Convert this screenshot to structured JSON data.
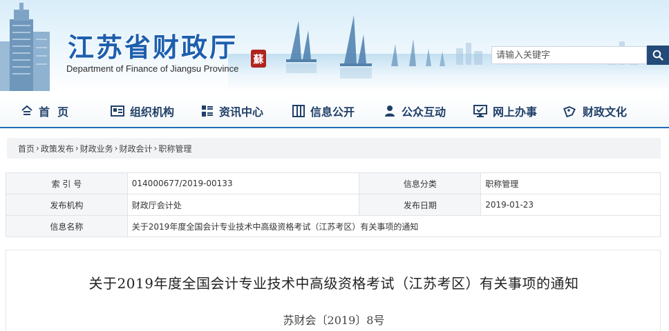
{
  "header": {
    "logo_title": "江苏省财政厅",
    "logo_subtitle": "Department of Finance of Jiangsu Province",
    "seal_char": "蘇",
    "search": {
      "placeholder": "请输入关键字",
      "icon": "search-icon"
    },
    "colors": {
      "title": "#1d5fae",
      "search_button": "#234a78",
      "seal": "#b0241e"
    }
  },
  "nav": {
    "items": [
      {
        "label": "首  页",
        "icon": "home-icon"
      },
      {
        "label": "组织机构",
        "icon": "org-card-icon"
      },
      {
        "label": "资讯中心",
        "icon": "news-icon"
      },
      {
        "label": "信息公开",
        "icon": "columns-icon"
      },
      {
        "label": "公众互动",
        "icon": "user-icon"
      },
      {
        "label": "网上办事",
        "icon": "monitor-check-icon"
      },
      {
        "label": "财政文化",
        "icon": "culture-icon"
      }
    ],
    "accent": "#1d6fb5"
  },
  "breadcrumb": {
    "items": [
      "首页",
      "政策发布",
      "财政业务",
      "财政会计",
      "职称管理"
    ],
    "separator": "›"
  },
  "info_table": {
    "rows": [
      [
        {
          "label": "索 引 号",
          "value": "014000677/2019-00133"
        },
        {
          "label": "信息分类",
          "value": "职称管理"
        }
      ],
      [
        {
          "label": "发布机构",
          "value": "财政厅会计处"
        },
        {
          "label": "发布日期",
          "value": "2019-01-23"
        }
      ],
      [
        {
          "label": "信息名称",
          "value": "关于2019年度全国会计专业技术中高级资格考试（江苏考区）有关事项的通知"
        }
      ]
    ]
  },
  "article": {
    "title": "关于2019年度全国会计专业技术中高级资格考试（江苏考区）有关事项的通知",
    "doc_number": "苏财会〔2019〕8号"
  }
}
